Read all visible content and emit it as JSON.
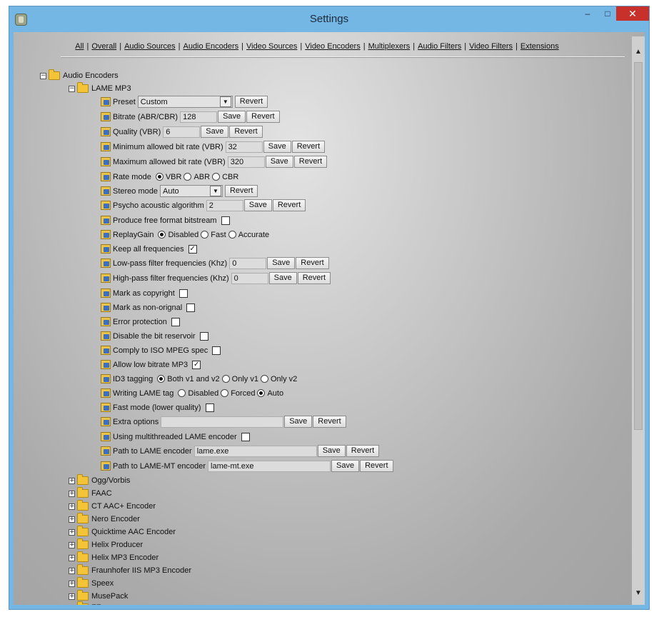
{
  "window": {
    "title": "Settings",
    "min_symbol": "–",
    "max_symbol": "□",
    "close_symbol": "✕"
  },
  "nav": {
    "links": [
      "All",
      "Overall",
      "Audio Sources",
      "Audio Encoders",
      "Video Sources",
      "Video Encoders",
      "Multiplexers",
      "Audio Filters",
      "Video Filters",
      "Extensions"
    ],
    "separator": "|"
  },
  "tree": {
    "root": {
      "toggle": "−",
      "label": "Audio Encoders"
    },
    "group": {
      "toggle": "−",
      "label": "LAME MP3"
    },
    "options": {
      "preset": {
        "label": "Preset",
        "value": "Custom",
        "revert": "Revert"
      },
      "bitrate": {
        "label": "Bitrate (ABR/CBR)",
        "value": "128",
        "save": "Save",
        "revert": "Revert"
      },
      "quality": {
        "label": "Quality (VBR)",
        "value": "6",
        "save": "Save",
        "revert": "Revert"
      },
      "min_bitrate": {
        "label": "Minimum allowed bit rate (VBR)",
        "value": "32",
        "save": "Save",
        "revert": "Revert"
      },
      "max_bitrate": {
        "label": "Maximum allowed bit rate (VBR)",
        "value": "320",
        "save": "Save",
        "revert": "Revert"
      },
      "rate_mode": {
        "label": "Rate mode",
        "options": [
          "VBR",
          "ABR",
          "CBR"
        ],
        "selected": "VBR"
      },
      "stereo_mode": {
        "label": "Stereo mode",
        "value": "Auto",
        "revert": "Revert"
      },
      "psycho": {
        "label": "Psycho acoustic algorithm",
        "value": "2",
        "save": "Save",
        "revert": "Revert"
      },
      "free_format": {
        "label": "Produce free format bitstream",
        "checked": false
      },
      "replaygain": {
        "label": "ReplayGain",
        "options": [
          "Disabled",
          "Fast",
          "Accurate"
        ],
        "selected": "Disabled"
      },
      "keep_freq": {
        "label": "Keep all frequencies",
        "checked": true
      },
      "lowpass": {
        "label": "Low-pass filter frequencies (Khz)",
        "value": "0",
        "save": "Save",
        "revert": "Revert"
      },
      "highpass": {
        "label": "High-pass filter frequencies (Khz)",
        "value": "0",
        "save": "Save",
        "revert": "Revert"
      },
      "copyright": {
        "label": "Mark as copyright",
        "checked": false
      },
      "non_original": {
        "label": "Mark as non-orignal",
        "checked": false
      },
      "error_protection": {
        "label": "Error protection",
        "checked": false
      },
      "disable_reservoir": {
        "label": "Disable the bit reservoir",
        "checked": false
      },
      "iso_spec": {
        "label": "Comply to ISO MPEG spec",
        "checked": false
      },
      "low_bitrate": {
        "label": "Allow low bitrate MP3",
        "checked": true
      },
      "id3": {
        "label": "ID3 tagging",
        "options": [
          "Both v1 and v2",
          "Only v1",
          "Only v2"
        ],
        "selected": "Both v1 and v2"
      },
      "lame_tag": {
        "label": "Writing LAME tag",
        "options": [
          "Disabled",
          "Forced",
          "Auto"
        ],
        "selected": "Auto"
      },
      "fast_mode": {
        "label": "Fast mode (lower quality)",
        "checked": false
      },
      "extra": {
        "label": "Extra options",
        "value": "",
        "save": "Save",
        "revert": "Revert"
      },
      "multithreaded": {
        "label": "Using multithreaded LAME encoder",
        "checked": false
      },
      "lame_path": {
        "label": "Path to LAME encoder",
        "value": "lame.exe",
        "save": "Save",
        "revert": "Revert"
      },
      "lamemt_path": {
        "label": "Path to LAME-MT encoder",
        "value": "lame-mt.exe",
        "save": "Save",
        "revert": "Revert"
      }
    },
    "collapsed_toggle": "+",
    "other_encoders": [
      "Ogg/Vorbis",
      "FAAC",
      "CT AAC+ Encoder",
      "Nero Encoder",
      "Quicktime AAC Encoder",
      "Helix Producer",
      "Helix MP3 Encoder",
      "Fraunhofer IIS MP3 Encoder",
      "Speex",
      "MusePack",
      "FF"
    ]
  },
  "scrollbar": {
    "up": "▲",
    "down": "▼"
  },
  "check_mark": "✓"
}
